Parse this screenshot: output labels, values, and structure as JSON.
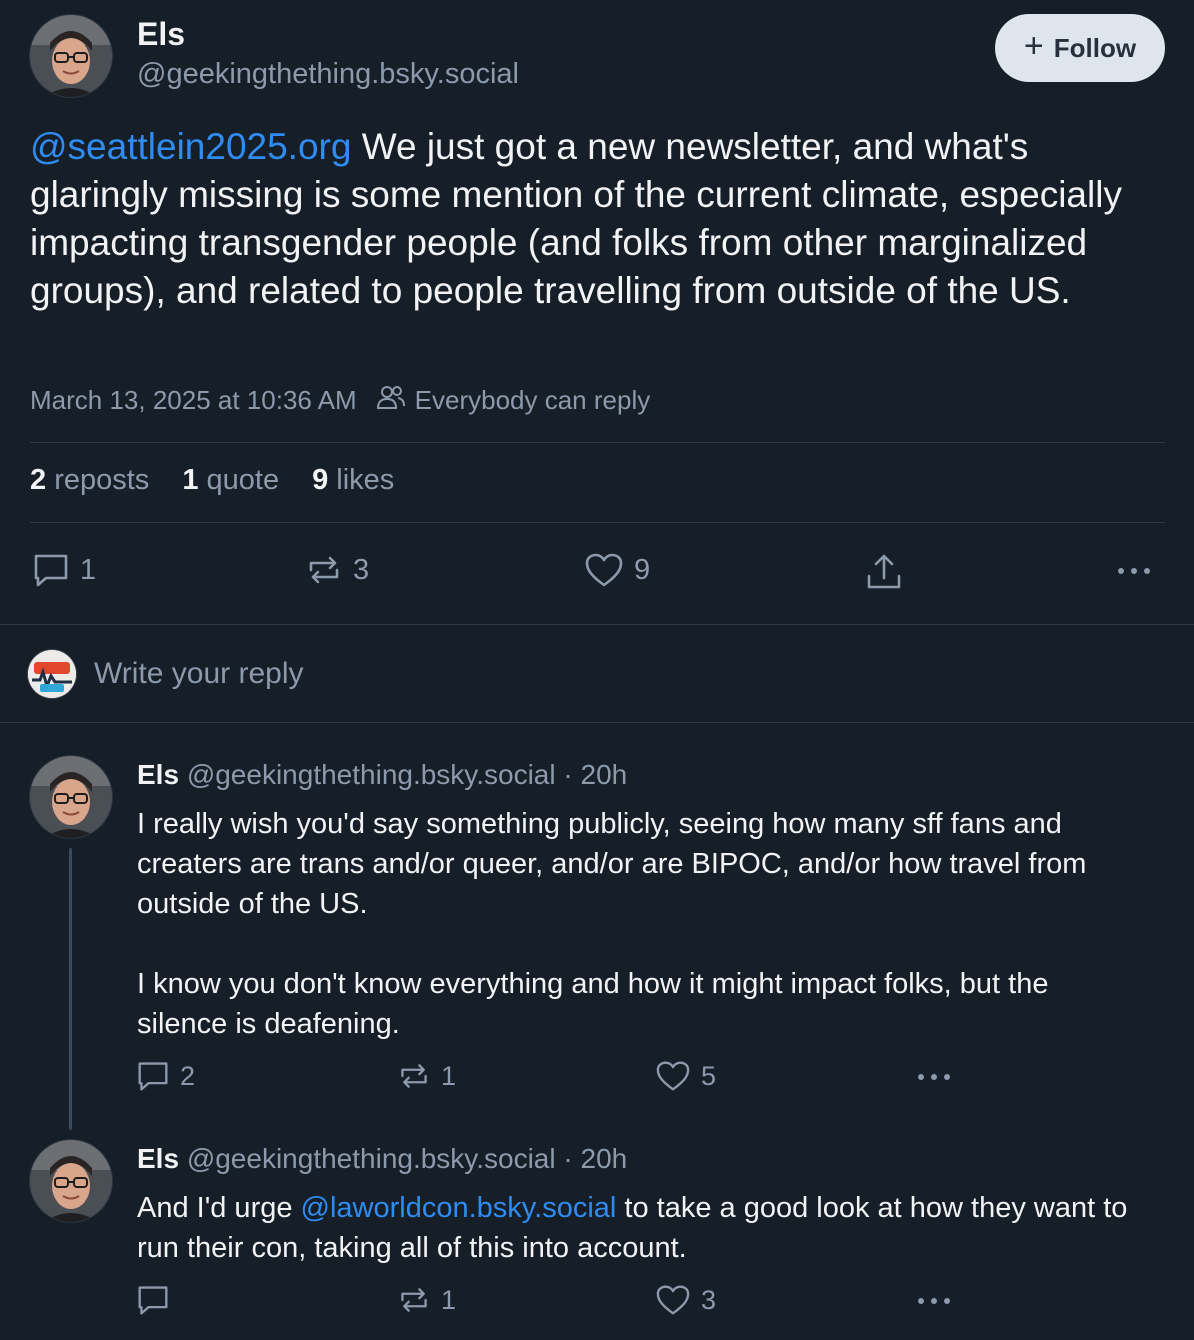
{
  "post": {
    "author_name": "Els",
    "author_handle": "@geekingthething.bsky.social",
    "follow_label": "Follow",
    "mention": "@seattlein2025.org",
    "text": " We just got a new newsletter, and what's glaringly missing is some mention of the current climate, especially impacting transgender people (and folks from other marginalized groups), and related to people travelling from outside of the US.",
    "timestamp": "March 13, 2025 at 10:36 AM",
    "reply_setting": "Everybody can reply",
    "counts": {
      "reposts_num": "2",
      "reposts_label": "reposts",
      "quotes_num": "1",
      "quotes_label": "quote",
      "likes_num": "9",
      "likes_label": "likes"
    },
    "actions": {
      "replies": "1",
      "reposts": "3",
      "likes": "9"
    }
  },
  "compose": {
    "placeholder": "Write your reply"
  },
  "replies": [
    {
      "author_name": "Els",
      "author_handle": "@geekingthething.bsky.social",
      "time": "· 20h",
      "text_1": "I really wish you'd say something publicly, seeing how many sff fans and creaters are trans and/or queer, and/or are BIPOC, and/or how travel from outside of the US.",
      "text_2": "I know you don't know everything and how it might impact folks, but the silence is deafening.",
      "actions": {
        "replies": "2",
        "reposts": "1",
        "likes": "5"
      }
    },
    {
      "author_name": "Els",
      "author_handle": "@geekingthething.bsky.social",
      "time": "· 20h",
      "text_pre": "And I'd urge ",
      "mention": "@laworldcon.bsky.social",
      "text_post": " to take a good look at how they want to run their con, taking all of this into account.",
      "actions": {
        "replies": "",
        "reposts": "1",
        "likes": "3"
      }
    }
  ],
  "colors": {
    "background": "#161e27",
    "link": "#2f8cf2",
    "muted": "#8c9aab",
    "follow_bg": "#dfe5ec"
  },
  "icons": [
    "avatar",
    "plus-icon",
    "people-icon",
    "comment-icon",
    "repost-icon",
    "heart-icon",
    "share-icon",
    "more-icon",
    "fandom-pulse-avatar"
  ]
}
